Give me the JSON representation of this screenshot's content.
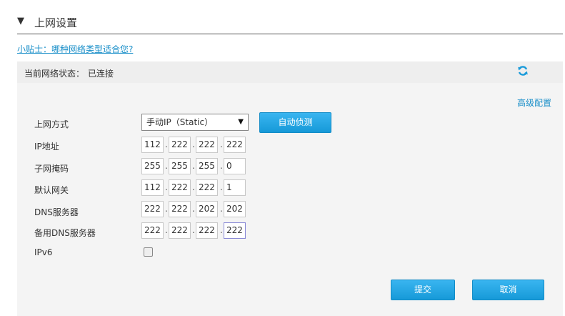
{
  "header": {
    "title": "上网设置",
    "arrow": "▼"
  },
  "tip": "小贴士：哪种网络类型适合您?",
  "status": {
    "label": "当前网络状态：",
    "value": "已连接"
  },
  "advanced_link": "高级配置",
  "fields": {
    "mode_label": "上网方式",
    "mode_value": "手动IP（Static）",
    "detect_button": "自动侦测",
    "ip_label": "IP地址",
    "ip": [
      "112",
      "222",
      "222",
      "222"
    ],
    "mask_label": "子网掩码",
    "mask": [
      "255",
      "255",
      "255",
      "0"
    ],
    "gateway_label": "默认网关",
    "gateway": [
      "112",
      "222",
      "222",
      "1"
    ],
    "dns_label": "DNS服务器",
    "dns": [
      "222",
      "222",
      "202",
      "202"
    ],
    "dns2_label": "备用DNS服务器",
    "dns2": [
      "222",
      "222",
      "222",
      "222"
    ],
    "ipv6_label": "IPv6"
  },
  "buttons": {
    "submit": "提交",
    "cancel": "取消"
  },
  "colors": {
    "accent": "#1a9bda",
    "link": "#1a8fc9",
    "panel_bg": "#f4f4f4"
  },
  "icons": {
    "refresh": "refresh-icon",
    "collapse": "triangle-down-icon"
  }
}
